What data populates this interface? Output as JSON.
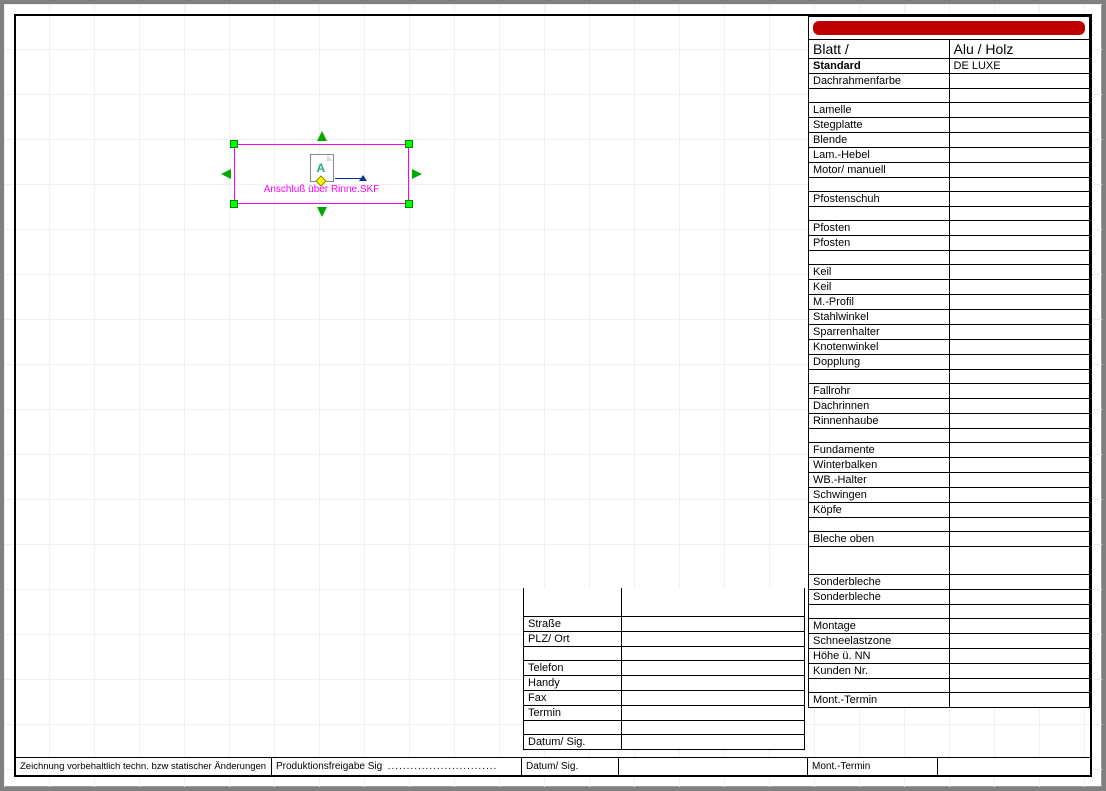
{
  "selection": {
    "filename": "Anschluß über Rinne.SKF"
  },
  "titleblock": {
    "header_left": "Blatt    /",
    "header_right": "Alu / Holz",
    "sub_left": "Standard",
    "sub_right": "DE LUXE",
    "rows": [
      "Dachrahmenfarbe",
      "",
      "Lamelle",
      "Stegplatte",
      "Blende",
      "Lam.-Hebel",
      "Motor/ manuell",
      "",
      "Pfostenschuh",
      "",
      "Pfosten",
      "Pfosten",
      "",
      "Keil",
      "Keil",
      "M.-Profil",
      "Stahlwinkel",
      "Sparrenhalter",
      "Knotenwinkel",
      "Dopplung",
      "",
      "Fallrohr",
      "Dachrinnen",
      "Rinnenhaube",
      "",
      "Fundamente",
      "Winterbalken",
      "WB.-Halter",
      "Schwingen",
      "Köpfe",
      "",
      "Bleche oben"
    ],
    "bottom_rows": [
      "Sonderbleche",
      "Sonderbleche",
      "",
      "Montage",
      "Schneelastzone",
      "Höhe ü. NN",
      "Kunden Nr.",
      "",
      "Mont.-Termin"
    ]
  },
  "contact": {
    "rows": [
      "",
      "",
      "Straße",
      "PLZ/ Ort",
      "",
      "Telefon",
      "Handy",
      "Fax",
      "Termin",
      "",
      "Datum/ Sig."
    ]
  },
  "footer": {
    "disclaimer": "Zeichnung vorbehaltlich techn. bzw statischer Änderungen",
    "prod": "Produktionsfreigabe Sig"
  }
}
